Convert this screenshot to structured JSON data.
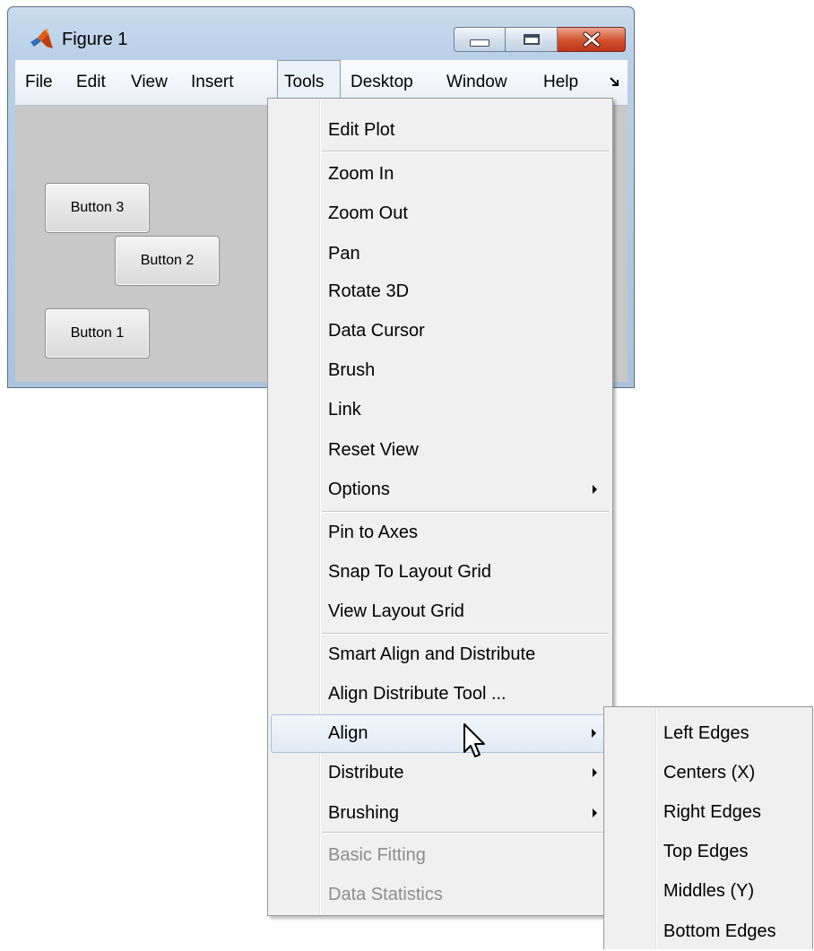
{
  "window": {
    "title": "Figure 1",
    "icon": "matlab-logo-icon",
    "controls": [
      "minimize-icon",
      "maximize-icon",
      "close-icon"
    ]
  },
  "menubar": {
    "items": [
      "File",
      "Edit",
      "View",
      "Insert",
      "Tools",
      "Desktop",
      "Window",
      "Help"
    ],
    "active": "Tools",
    "overflow_icon": "dock-arrow-icon"
  },
  "canvas": {
    "background": "#c8c8c8",
    "buttons": [
      "Button 3",
      "Button 2",
      "Button 1"
    ]
  },
  "tools_menu": {
    "items": [
      {
        "label": "Edit Plot"
      },
      {
        "label": "Zoom In"
      },
      {
        "label": "Zoom Out"
      },
      {
        "label": "Pan"
      },
      {
        "label": "Rotate 3D"
      },
      {
        "label": "Data Cursor"
      },
      {
        "label": "Brush"
      },
      {
        "label": "Link"
      },
      {
        "label": "Reset View"
      },
      {
        "label": "Options",
        "submenu": true
      },
      {
        "label": "Pin to Axes"
      },
      {
        "label": "Snap To Layout Grid"
      },
      {
        "label": "View Layout Grid"
      },
      {
        "label": "Smart Align and Distribute"
      },
      {
        "label": "Align Distribute Tool ..."
      },
      {
        "label": "Align",
        "submenu": true,
        "highlighted": true
      },
      {
        "label": "Distribute",
        "submenu": true
      },
      {
        "label": "Brushing",
        "submenu": true
      },
      {
        "label": "Basic Fitting",
        "disabled": true
      },
      {
        "label": "Data Statistics",
        "disabled": true
      }
    ]
  },
  "align_submenu": {
    "items": [
      "Left Edges",
      "Centers (X)",
      "Right Edges",
      "Top Edges",
      "Middles (Y)",
      "Bottom Edges"
    ]
  },
  "colors": {
    "menu_highlight": "#e1eaf6",
    "close_button": "#d2502c",
    "disabled_text": "#8d8d8d"
  }
}
